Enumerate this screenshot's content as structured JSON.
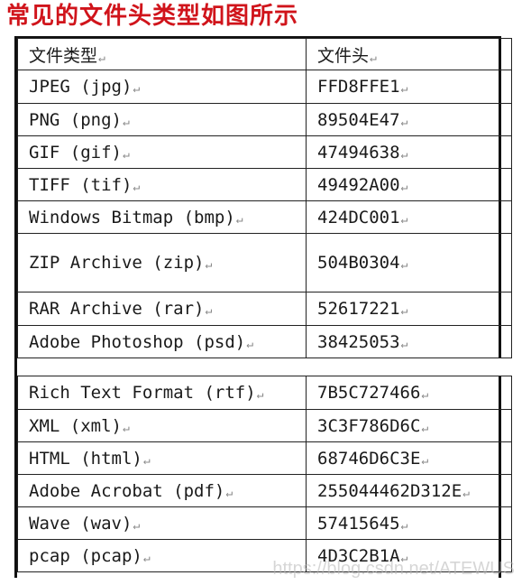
{
  "title": "常见的文件头类型如图所示",
  "table": {
    "headers": [
      "文件类型",
      "文件头"
    ],
    "rows": [
      {
        "type": "JPEG (jpg)",
        "header": "FFD8FFE1"
      },
      {
        "type": "PNG (png)",
        "header": "89504E47"
      },
      {
        "type": "GIF (gif)",
        "header": "47494638"
      },
      {
        "type": "TIFF (tif)",
        "header": "49492A00"
      },
      {
        "type": "Windows Bitmap (bmp)",
        "header": "424DC001"
      },
      {
        "type": "ZIP Archive (zip)",
        "header": "504B0304"
      },
      {
        "type": "RAR Archive (rar)",
        "header": "52617221"
      },
      {
        "type": "Adobe Photoshop (psd)",
        "header": "38425053"
      },
      {
        "type": "Rich Text Format (rtf)",
        "header": "7B5C727466"
      },
      {
        "type": "XML (xml)",
        "header": "3C3F786D6C"
      },
      {
        "type": "HTML (html)",
        "header": "68746D6C3E"
      },
      {
        "type": "Adobe Acrobat (pdf)",
        "header": "255044462D312E"
      },
      {
        "type": "Wave (wav)",
        "header": "57415645"
      },
      {
        "type": "pcap (pcap)",
        "header": "4D3C2B1A"
      }
    ]
  },
  "paragraph_mark": "↵",
  "watermark": "https://blog.csdn.net/ATEWUS"
}
